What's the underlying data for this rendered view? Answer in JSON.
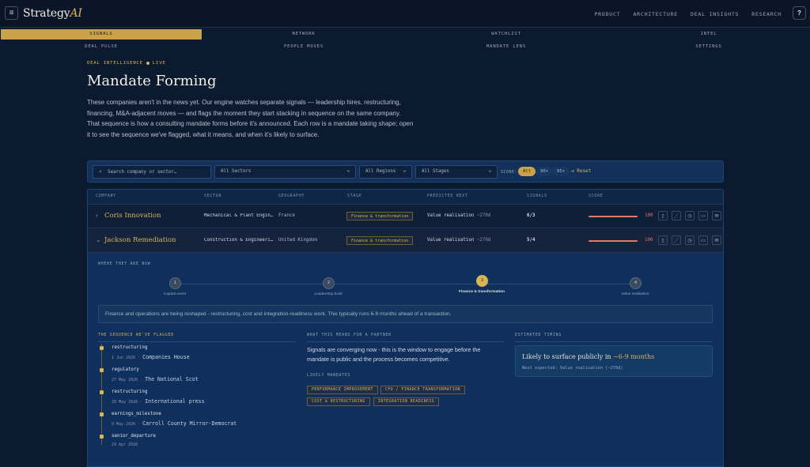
{
  "app": {
    "logo_main": "Strategy",
    "logo_accent": "AI"
  },
  "topnav": [
    "PRODUCT",
    "ARCHITECTURE",
    "DEAL INSIGHTS",
    "RESEARCH"
  ],
  "tabs": [
    {
      "label": "SIGNALS",
      "active": true
    },
    {
      "label": "NETWORK"
    },
    {
      "label": "WATCHLIST"
    },
    {
      "label": "INTEL"
    },
    {
      "label": "DEAL PULSE"
    },
    {
      "label": "PEOPLE MOVES"
    },
    {
      "label": "MANDATE LENS"
    },
    {
      "label": "SETTINGS"
    }
  ],
  "header": {
    "kicker_left": "DEAL INTELLIGENCE",
    "kicker_right": "LIVE",
    "title": "Mandate Forming",
    "intro": "These companies aren't in the news yet. Our engine watches separate signals — leadership hires, restructuring, financing, M&A-adjacent moves — and flags the moment they start stacking in sequence on the same company. That sequence is how a consulting mandate forms before it's announced. Each row is a mandate taking shape; open it to see the sequence we've flagged, what it means, and when it's likely to surface."
  },
  "filters": {
    "search_placeholder": "Search company or sector…",
    "sectors": "All Sectors",
    "regions": "All Regions",
    "stages": "All Stages",
    "score_label": "SCORE:",
    "score_options": [
      "All",
      "90+",
      "95+"
    ],
    "reset": "↺ Reset"
  },
  "table": {
    "headers": [
      "COMPANY",
      "SECTOR",
      "GEOGRAPHY",
      "STAGE",
      "PREDICTED NEXT",
      "SIGNALS",
      "SCORE"
    ],
    "rows": [
      {
        "company": "Coris Innovation",
        "sector": "Mechanical & Plant Engin…",
        "geography": "France",
        "stage": "Finance & transformation",
        "predicted": "Value realisation",
        "eta": "~270d",
        "signals": "6/3",
        "score": "100",
        "expanded": false
      },
      {
        "company": "Jackson Remediation",
        "sector": "Construction & Engineeri…",
        "geography": "United Kingdom",
        "stage": "Finance & transformation",
        "predicted": "Value realisation",
        "eta": "~270d",
        "signals": "5/4",
        "score": "100",
        "expanded": true
      }
    ]
  },
  "detail": {
    "where_label": "WHERE THEY ARE NOW",
    "steps": [
      {
        "num": "1",
        "label": "Capital event"
      },
      {
        "num": "2",
        "label": "Leadership build"
      },
      {
        "num": "3",
        "label": "Finance & transformation",
        "active": true
      },
      {
        "num": "4",
        "label": "Value realisation"
      }
    ],
    "summary": "Finance and operations are being reshaped - restructuring, cost and integration-readiness work. This typically runs 6-9 months ahead of a transaction.",
    "sequence_label": "THE SEQUENCE WE'VE FLAGGED",
    "sequence": [
      {
        "type": "restructuring",
        "date": "1 Jun 2026",
        "source": "Companies House"
      },
      {
        "type": "regulatory",
        "date": "27 May 2026",
        "source": "The National Scot"
      },
      {
        "type": "restructuring",
        "date": "20 May 2026",
        "source": "International press"
      },
      {
        "type": "earnings_milestone",
        "date": "9 May 2026",
        "source": "Carroll County Mirror-Democrat"
      },
      {
        "type": "senior_departure",
        "date": "29 Apr 2026",
        "source": ""
      }
    ],
    "partner_label": "WHAT THIS MEANS FOR A PARTNER",
    "partner_text": "Signals are converging now - this is the window to engage before the mandate is public and the process becomes competitive.",
    "mandates_label": "LIKELY MANDATES",
    "mandates": [
      "PERFORMANCE IMPROVEMENT",
      "CFO / FINANCE TRANSFORMATION",
      "COST & RESTRUCTURING",
      "INTEGRATION READINESS"
    ],
    "timing_label": "ESTIMATED TIMING",
    "timing_main": "Likely to surface publicly in ",
    "timing_highlight": "~6-9 months",
    "timing_sub": "Next expected: Value realisation (~270d)"
  },
  "colors": {
    "accent": "#d8b557",
    "score": "#e07a6e",
    "background": "#0c1a30",
    "panel": "#0f2f5c"
  }
}
